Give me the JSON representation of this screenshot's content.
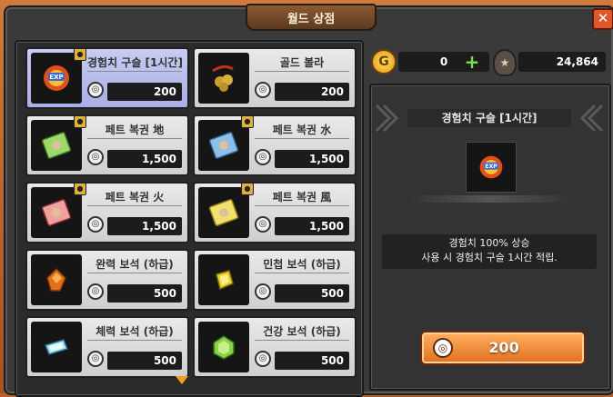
{
  "window": {
    "title": "월드 상점",
    "close_label": "✕"
  },
  "items": [
    {
      "name": "경험치 구슬 [1시간]",
      "price": "200",
      "icon": "exp-orb-icon",
      "selected": true,
      "locked": true
    },
    {
      "name": "골드 볼라",
      "price": "200",
      "icon": "gold-bola-icon",
      "selected": false,
      "locked": false
    },
    {
      "name": "페트 복권 地",
      "price": "1,500",
      "icon": "pet-ticket-earth-icon",
      "selected": false,
      "locked": true
    },
    {
      "name": "페트 복권 水",
      "price": "1,500",
      "icon": "pet-ticket-water-icon",
      "selected": false,
      "locked": true
    },
    {
      "name": "페트 복권 火",
      "price": "1,500",
      "icon": "pet-ticket-fire-icon",
      "selected": false,
      "locked": true
    },
    {
      "name": "페트 복권 風",
      "price": "1,500",
      "icon": "pet-ticket-wind-icon",
      "selected": false,
      "locked": true
    },
    {
      "name": "완력 보석 (하급)",
      "price": "500",
      "icon": "strength-gem-icon",
      "selected": false,
      "locked": false
    },
    {
      "name": "민첩 보석 (하급)",
      "price": "500",
      "icon": "agility-gem-icon",
      "selected": false,
      "locked": false
    },
    {
      "name": "체력 보석 (하급)",
      "price": "500",
      "icon": "vitality-gem-icon",
      "selected": false,
      "locked": false
    },
    {
      "name": "건강 보석 (하급)",
      "price": "500",
      "icon": "health-gem-icon",
      "selected": false,
      "locked": false
    }
  ],
  "currency": {
    "gold": "0",
    "plus": "+",
    "medals": "24,864"
  },
  "detail": {
    "title": "경험치 구슬 [1시간]",
    "desc_line1": "경험치 100% 상승",
    "desc_line2": "사용 시 경험치 구슬 1시간 적립.",
    "buy_price": "200"
  },
  "colors": {
    "accent": "#e07020",
    "panel": "#3a3a3a",
    "selected_item": "#b8bdf0"
  }
}
